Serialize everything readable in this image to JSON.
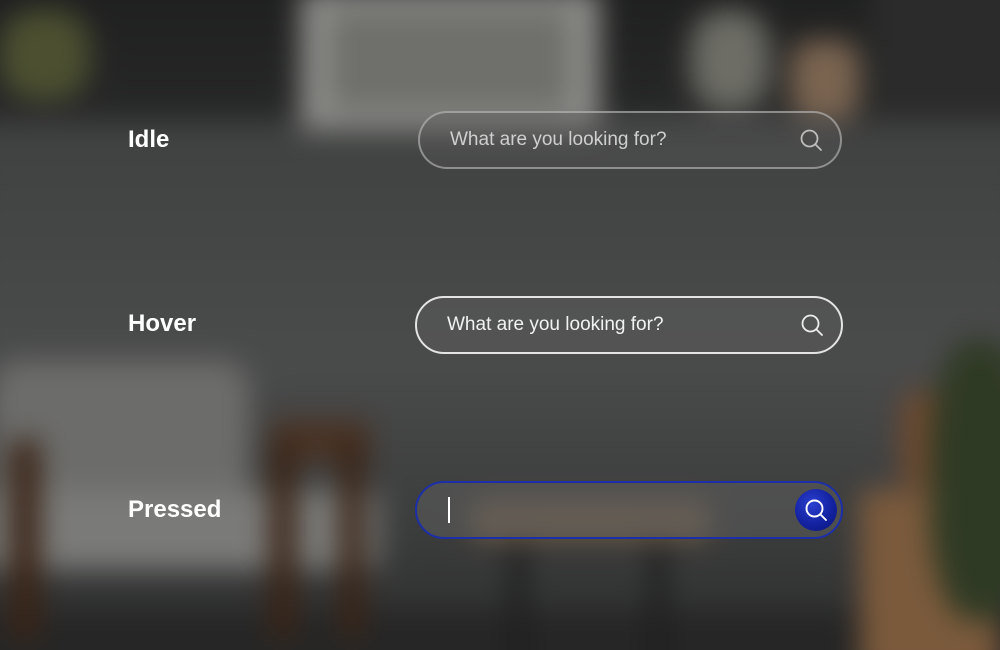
{
  "states": {
    "idle": {
      "label": "Idle",
      "placeholder": "What are you looking for?"
    },
    "hover": {
      "label": "Hover",
      "placeholder": "What are you looking for?"
    },
    "pressed": {
      "label": "Pressed",
      "value": ""
    }
  },
  "icons": {
    "search": "search-icon"
  },
  "colors": {
    "label_text": "#ffffff",
    "idle_border": "#c8c8c8",
    "hover_border": "#e4e4e4",
    "pressed_border": "#1c2fa8",
    "pressed_button": "#1322a0",
    "placeholder_text": "#cfcfcf"
  }
}
